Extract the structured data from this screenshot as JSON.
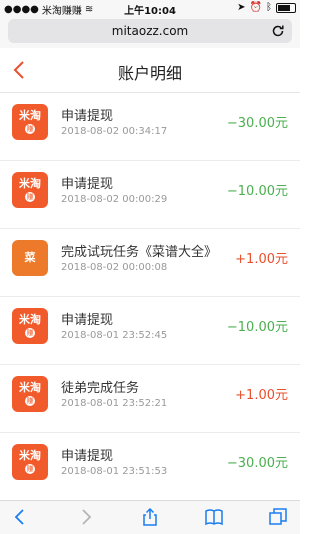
{
  "status": {
    "carrier": "米淘赚赚",
    "time": "上午10:04"
  },
  "browser": {
    "url": "mitaozz.com"
  },
  "header": {
    "title": "账户明细"
  },
  "colors": {
    "negative": "#4caf50",
    "positive": "#e8502e",
    "brand": "#f15a2b"
  },
  "records": [
    {
      "icon": "mitao",
      "logo_text": "米淘",
      "logo_badge": "赚",
      "title": "申请提现",
      "time": "2018-08-02 00:34:17",
      "amount": "−30.00元",
      "sign": "negative"
    },
    {
      "icon": "mitao",
      "logo_text": "米淘",
      "logo_badge": "赚",
      "title": "申请提现",
      "time": "2018-08-02 00:00:29",
      "amount": "−10.00元",
      "sign": "negative"
    },
    {
      "icon": "caipu",
      "logo_text": "菜",
      "title": "完成试玩任务《菜谱大全》",
      "time": "2018-08-02 00:00:08",
      "amount": "+1.00元",
      "sign": "positive"
    },
    {
      "icon": "mitao",
      "logo_text": "米淘",
      "logo_badge": "赚",
      "title": "申请提现",
      "time": "2018-08-01 23:52:45",
      "amount": "−10.00元",
      "sign": "negative"
    },
    {
      "icon": "mitao",
      "logo_text": "米淘",
      "logo_badge": "赚",
      "title": "徒弟完成任务",
      "time": "2018-08-01 23:52:21",
      "amount": "+1.00元",
      "sign": "positive"
    },
    {
      "icon": "mitao",
      "logo_text": "米淘",
      "logo_badge": "赚",
      "title": "申请提现",
      "time": "2018-08-01 23:51:53",
      "amount": "−30.00元",
      "sign": "negative"
    }
  ]
}
